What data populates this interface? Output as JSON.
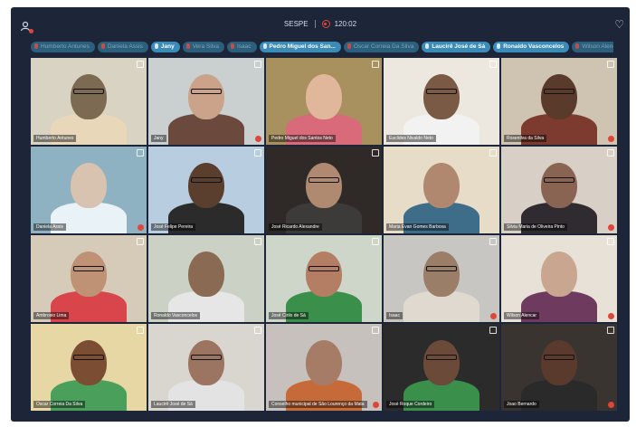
{
  "meeting": {
    "title": "SESPE",
    "timer": "120:02"
  },
  "icons": {
    "user": "participants-icon",
    "heart": "heart-icon",
    "record": "record-icon"
  },
  "participant_chips": [
    {
      "label": "Humberto Antunes",
      "active": false
    },
    {
      "label": "Daniela Assis",
      "active": false
    },
    {
      "label": "Jany",
      "active": true
    },
    {
      "label": "Vera Silva",
      "active": false
    },
    {
      "label": "Isaac",
      "active": false
    },
    {
      "label": "Pedro Miguel dos San...",
      "active": true
    },
    {
      "label": "Oscar Correia Da Silva",
      "active": false
    },
    {
      "label": "Laucirê José de Sá",
      "active": true
    },
    {
      "label": "Ronaldo Vasconcelos",
      "active": true
    },
    {
      "label": "Wilson Alencar",
      "active": false
    }
  ],
  "tiles": [
    {
      "name": "Humberto Antunes",
      "active": false
    },
    {
      "name": "Jany",
      "active": true
    },
    {
      "name": "Pedro Miguel dos Santos Neto",
      "active": false
    },
    {
      "name": "Euclides Nivaldo Neto",
      "active": false
    },
    {
      "name": "Rosenilva da Silva",
      "active": false
    },
    {
      "name": "Daniela Assis",
      "active": false
    },
    {
      "name": "José Felipe Pereira",
      "active": false
    },
    {
      "name": "José Ricardo Alexandre",
      "active": false
    },
    {
      "name": "Maria Evan Gomes Barbosa",
      "active": false
    },
    {
      "name": "Silvia Maria de Oliveira Pinto",
      "active": false
    },
    {
      "name": "Ambrosio Lima",
      "active": false
    },
    {
      "name": "Ronaldo Vasconcelos",
      "active": false
    },
    {
      "name": "José Cirilo de Sá",
      "active": false
    },
    {
      "name": "Isaac",
      "active": false
    },
    {
      "name": "Wilson Alencar",
      "active": false
    },
    {
      "name": "Oscar Correia Da Silva",
      "active": false
    },
    {
      "name": "Laucirê José de Sá",
      "active": false
    },
    {
      "name": "Conselho municipal de São Lourenço da Mata",
      "active": false
    },
    {
      "name": "José Roque Cordeiro",
      "active": false
    },
    {
      "name": "Joao Bernardo",
      "active": false
    }
  ]
}
